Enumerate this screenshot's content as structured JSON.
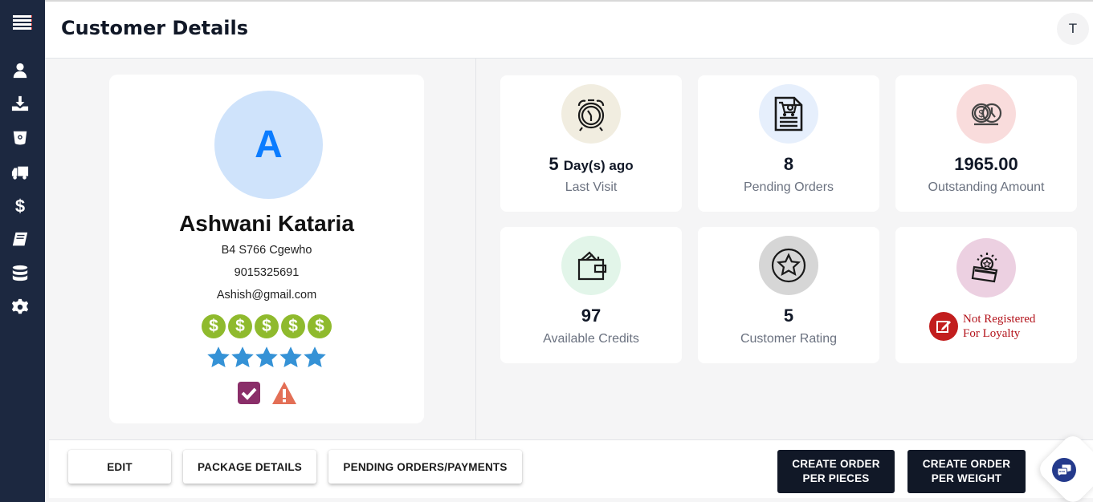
{
  "sidebar": {
    "menu_icon": "hamburger-menu-icon",
    "items": [
      {
        "icon": "user-icon",
        "name": "customers"
      },
      {
        "icon": "download-tray-icon",
        "name": "inbound"
      },
      {
        "icon": "bucket-icon",
        "name": "washing"
      },
      {
        "icon": "truck-icon",
        "name": "delivery"
      },
      {
        "icon": "dollar-icon",
        "name": "payments"
      },
      {
        "icon": "book-icon",
        "name": "ledger"
      },
      {
        "icon": "database-icon",
        "name": "data"
      },
      {
        "icon": "gear-icon",
        "name": "settings"
      }
    ]
  },
  "header": {
    "title": "Customer Details",
    "user_initial": "T"
  },
  "customer": {
    "initial": "A",
    "name": "Ashwani Kataria",
    "address": "B4 S766 Cgewho",
    "phone": "9015325691",
    "email": "Ashish@gmail.com",
    "dollar_level": 5,
    "star_rating": 5,
    "dollar_symbol": "$",
    "flags": [
      "verified-check-icon",
      "warning-icon"
    ]
  },
  "stats": [
    {
      "key": "last_visit",
      "value": "5",
      "unit": "Day(s) ago",
      "label": "Last Visit",
      "icon": "alarm-clock-icon",
      "bg": "#f1ede0"
    },
    {
      "key": "pending_orders",
      "value": "8",
      "unit": "",
      "label": "Pending Orders",
      "icon": "order-document-icon",
      "bg": "#e6effc"
    },
    {
      "key": "outstanding",
      "value": "1965.00",
      "unit": "",
      "label": "Outstanding Amount",
      "icon": "coins-clock-icon",
      "bg": "#f9dcdc"
    },
    {
      "key": "credits",
      "value": "97",
      "unit": "",
      "label": "Available Credits",
      "icon": "wallet-icon",
      "bg": "#e2f5e9"
    },
    {
      "key": "rating",
      "value": "5",
      "unit": "",
      "label": "Customer Rating",
      "icon": "star-badge-icon",
      "bg": "#d6d6d6"
    },
    {
      "key": "loyalty",
      "value": "",
      "unit": "",
      "label": "",
      "icon": "loyalty-card-icon",
      "bg": "#ecd0e1"
    }
  ],
  "loyalty": {
    "line1": "Not Registered",
    "line2": "For Loyalty",
    "color": "#b3131b"
  },
  "actions": {
    "edit": "EDIT",
    "package_details": "PACKAGE DETAILS",
    "pending_orders_payments": "PENDING ORDERS/PAYMENTS",
    "create_pieces_l1": "CREATE ORDER",
    "create_pieces_l2": "PER PIECES",
    "create_weight_l1": "CREATE ORDER",
    "create_weight_l2": "PER WEIGHT"
  },
  "chat": {
    "icon": "chat-bubbles-icon"
  },
  "colors": {
    "sidebar": "#1c2840",
    "accent": "#0b7cff",
    "dark_button": "#111827",
    "dollar_green": "#8fba2d",
    "star_blue": "#3592d6"
  }
}
